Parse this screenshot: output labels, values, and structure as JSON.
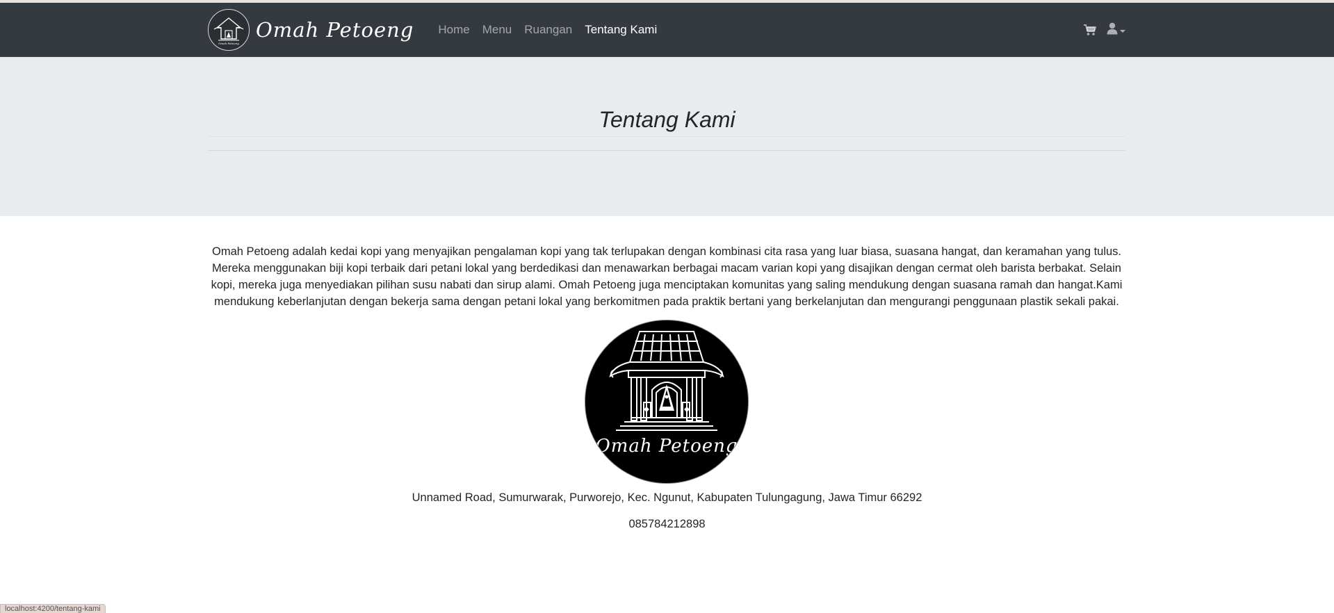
{
  "navbar": {
    "brand_name": "Omah Petoeng",
    "links": [
      {
        "label": "Home"
      },
      {
        "label": "Menu"
      },
      {
        "label": "Ruangan"
      },
      {
        "label": "Tentang Kami"
      }
    ],
    "cart_icon": "shopping-cart-icon",
    "user_icon": "user-icon"
  },
  "jumbotron": {
    "title": "Tentang Kami"
  },
  "about": {
    "description": "Omah Petoeng adalah kedai kopi yang menyajikan pengalaman kopi yang tak terlupakan dengan kombinasi cita rasa yang luar biasa, suasana hangat, dan keramahan yang tulus. Mereka menggunakan biji kopi terbaik dari petani lokal yang berdedikasi dan menawarkan berbagai macam varian kopi yang disajikan dengan cermat oleh barista berbakat. Selain kopi, mereka juga menyediakan pilihan susu nabati dan sirup alami. Omah Petoeng juga menciptakan komunitas yang saling mendukung dengan suasana ramah dan hangat.Kami mendukung keberlanjutan dengan bekerja sama dengan petani lokal yang berkomitmen pada praktik bertani yang berkelanjutan dan mengurangi penggunaan plastik sekali pakai.",
    "logo_text": "Omah Petoeng",
    "address": "Unnamed Road, Sumurwarak, Purworejo, Kec. Ngunut, Kabupaten Tulungagung, Jawa Timur 66292",
    "phone": "085784212898"
  },
  "status_bar": {
    "url": "localhost:4200/tentang-kami"
  },
  "colors": {
    "navbar_bg": "#343a40",
    "jumbotron_bg": "#e9ecef"
  }
}
